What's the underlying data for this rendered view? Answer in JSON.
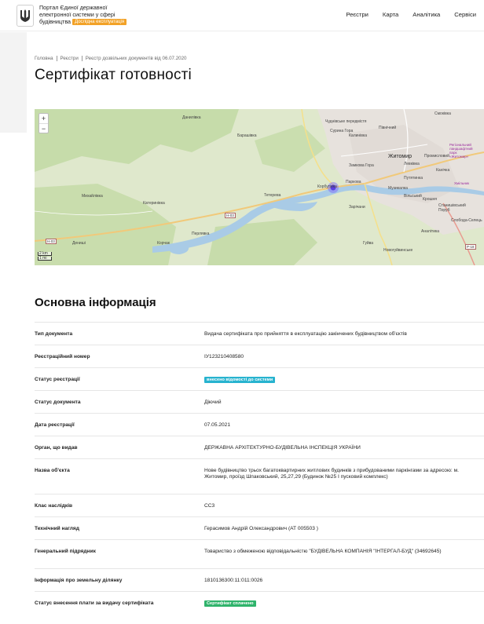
{
  "header": {
    "logo_line1": "Портал Єдиної державної",
    "logo_line2": "електронної системи у сфері",
    "logo_line3": "будівництва",
    "beta_label": "Дослідна експлуатація",
    "nav": [
      "Реєстри",
      "Карта",
      "Аналітика",
      "Сервіси"
    ]
  },
  "breadcrumb": [
    "Головна",
    "Реєстри",
    "Реєстр дозвільних документів від 06.07.2020"
  ],
  "page_title": "Сертифікат готовності",
  "map": {
    "zoom_in": "+",
    "zoom_out": "−",
    "scale_km": "2 km",
    "scale_mi": "1 mi",
    "labels": {
      "chudnivsky": "Чуднівське передмістя",
      "pivnichny": "Північний",
      "danylivka": "Данилівка",
      "barashivka": "Барашівка",
      "suryna": "Сурина Гора",
      "kalyni": "Калинівка",
      "zhytomyr": "Житомир",
      "zamkova": "Замкова Гора",
      "promyslovyi": "Промисловий",
      "levanivka": "Левківка",
      "kanychka": "Канічка",
      "putyatynka": "Путятинка",
      "smokovka": "Смоківка",
      "mykhailivka": "Михайлівка",
      "katerynivka": "Катеринівка",
      "tetereva": "Тетерева",
      "korbutivka": "Корбутівка",
      "parkivka": "Паркова",
      "muzhykivka": "Музикалка",
      "vilskyi": "Вільський",
      "zarichany": "Зарічани",
      "krosnya": "Крошня",
      "stanishivsky": "Станишівський Поруб",
      "sloboda": "Слобода-Селець",
      "perovka": "Перлявка",
      "denyshi": "Дениші",
      "korchak": "Корчак",
      "guyva": "Гуйва",
      "novoguivynske": "Новогуйвинське",
      "analitka": "Аналітика",
      "regional": "Регіональний ландшафтний парк «Житомир»",
      "khmilnyk": "Хмільник",
      "h03": "H-03",
      "p18": "P-18",
      "m03": "H-03"
    }
  },
  "section_title": "Основна інформація",
  "rows": [
    {
      "label": "Тип документа",
      "value": "Видача сертифіката про прийняття в експлуатацію закінчених будівництвом об'єктів"
    },
    {
      "label": "Реєстраційний номер",
      "value": "IУ123210408580"
    },
    {
      "label": "Статус реєстрації",
      "badge": "внесено відомості до системи",
      "badge_color": "#27b3cf"
    },
    {
      "label": "Статус документа",
      "value": "Діючий"
    },
    {
      "label": "Дата реєстрації",
      "value": "07.05.2021"
    },
    {
      "label": "Орган, що видав",
      "value": "ДЕРЖАВНА АРХІТЕКТУРНО-БУДІВЕЛЬНА ІНСПЕКЦІЯ УКРАЇНИ"
    },
    {
      "label": "Назва об'єкта",
      "value": "Нове будівництво трьох багатоквартирних житлових будинків з прибудованими паркінгами за адресою: м. Житомир, проїзд Шпаковський, 25,27,29 (Будинок №25 I пусковий комплекс)"
    },
    {
      "label": "Клас наслідків",
      "value": "СС3"
    },
    {
      "label": "Технічний нагляд",
      "value": "Герасимов Андрій Олександрович (АТ 005503 )"
    },
    {
      "label": "Генеральний підрядник",
      "value": "Товариство з обмеженою відповідальністю \"БУДІВЕЛЬНА КОМПАНІЯ \"ІНТЕРГАЛ-БУД\" (34692645)"
    },
    {
      "label": "Інформація про земельну ділянку",
      "value": "1810136300:11:011:0026"
    },
    {
      "label": "Статус внесення плати за видачу сертифіката",
      "badge": "Сертифікат сплачено",
      "badge_color": "#2fb36b"
    }
  ]
}
